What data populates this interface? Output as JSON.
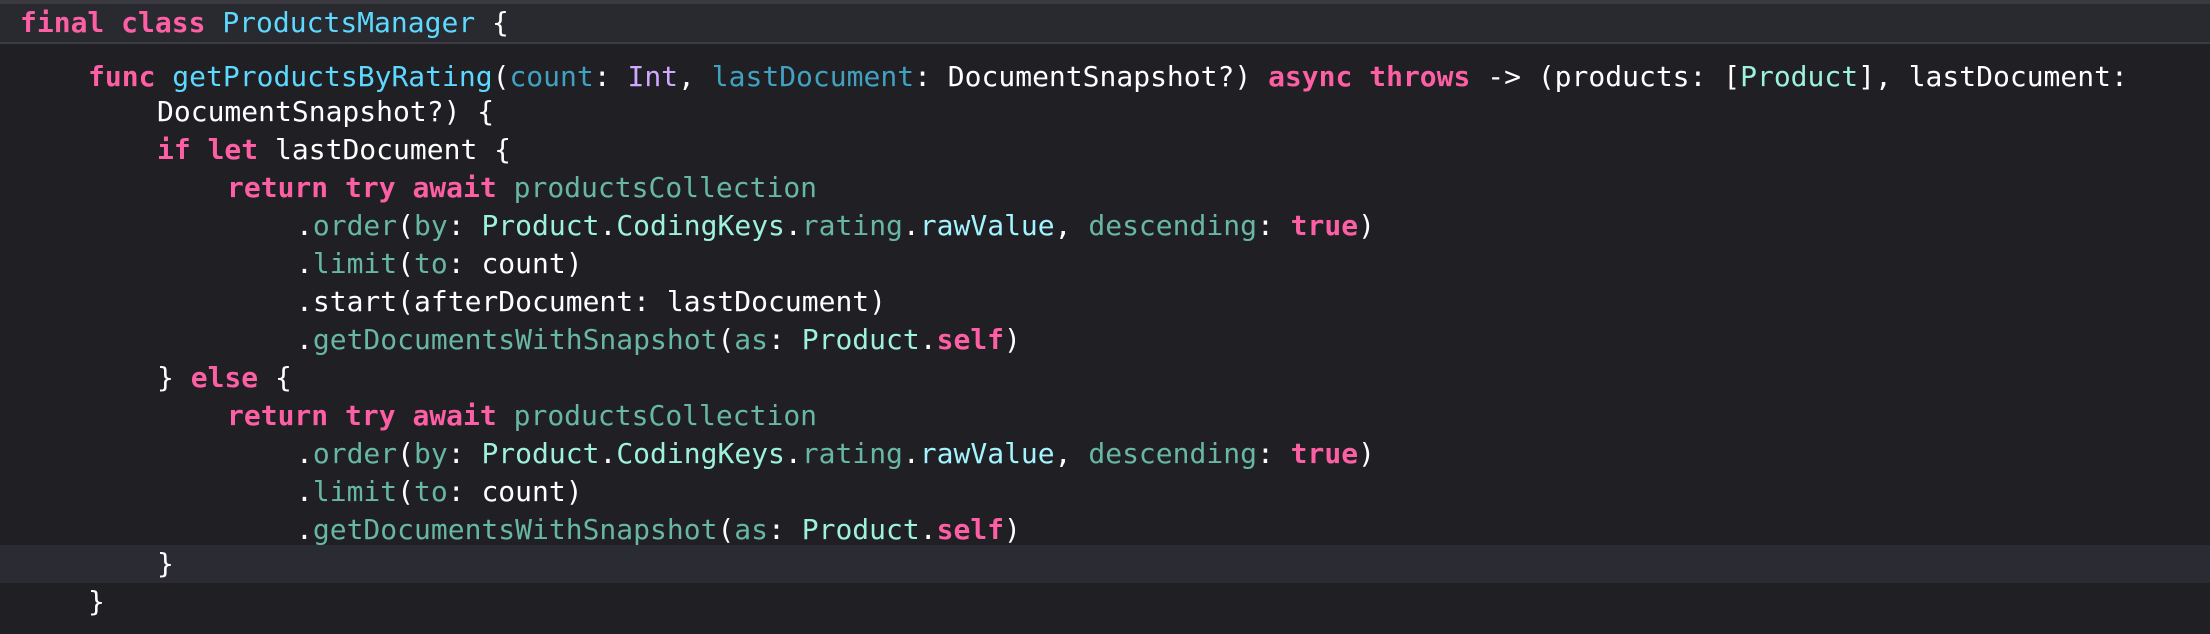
{
  "editor": {
    "language": "Swift",
    "theme_colors": {
      "background": "#1f1f24",
      "header_background": "#292a30",
      "current_line": "#2b2c33",
      "keyword": "#fc5fa3",
      "declaration": "#5dd8ff",
      "type": "#9ef1dd",
      "property": "#67b7a4",
      "other_property": "#a167e6",
      "text": "#ffffff"
    },
    "lines": [
      {
        "indent": 0,
        "tokens": [
          {
            "text": "final",
            "kind": "kw"
          },
          {
            "text": " ",
            "kind": "plain"
          },
          {
            "text": "class",
            "kind": "kw"
          },
          {
            "text": " ",
            "kind": "plain"
          },
          {
            "text": "ProductsManager",
            "kind": "decl"
          },
          {
            "text": " {",
            "kind": "plain"
          }
        ]
      },
      {
        "indent": 1,
        "tokens": [
          {
            "text": "func",
            "kind": "kw"
          },
          {
            "text": " ",
            "kind": "plain"
          },
          {
            "text": "getProductsByRating",
            "kind": "decl"
          },
          {
            "text": "(",
            "kind": "plain"
          },
          {
            "text": "count",
            "kind": "pc"
          },
          {
            "text": ": ",
            "kind": "plain"
          },
          {
            "text": "Int",
            "kind": "type"
          },
          {
            "text": ", ",
            "kind": "plain"
          },
          {
            "text": "lastDocument",
            "kind": "pc"
          },
          {
            "text": ": DocumentSnapshot?) ",
            "kind": "plain"
          },
          {
            "text": "async",
            "kind": "kw"
          },
          {
            "text": " ",
            "kind": "plain"
          },
          {
            "text": "throws",
            "kind": "kw"
          },
          {
            "text": " -> (products: [",
            "kind": "plain"
          },
          {
            "text": "Product",
            "kind": "cls"
          },
          {
            "text": "], lastDocument:",
            "kind": "plain"
          }
        ]
      },
      {
        "indent": 2,
        "tokens": [
          {
            "text": "DocumentSnapshot?) {",
            "kind": "plain"
          }
        ]
      },
      {
        "indent": 2,
        "tokens": [
          {
            "text": "if",
            "kind": "kw"
          },
          {
            "text": " ",
            "kind": "plain"
          },
          {
            "text": "let",
            "kind": "kw"
          },
          {
            "text": " lastDocument {",
            "kind": "plain"
          }
        ]
      },
      {
        "indent": 3,
        "tokens": [
          {
            "text": "return",
            "kind": "kw"
          },
          {
            "text": " ",
            "kind": "plain"
          },
          {
            "text": "try",
            "kind": "kw"
          },
          {
            "text": " ",
            "kind": "plain"
          },
          {
            "text": "await",
            "kind": "kw"
          },
          {
            "text": " ",
            "kind": "plain"
          },
          {
            "text": "productsCollection",
            "kind": "prop"
          }
        ]
      },
      {
        "indent": 4,
        "tokens": [
          {
            "text": ".",
            "kind": "plain"
          },
          {
            "text": "order",
            "kind": "prop"
          },
          {
            "text": "(",
            "kind": "plain"
          },
          {
            "text": "by",
            "kind": "prop"
          },
          {
            "text": ": ",
            "kind": "plain"
          },
          {
            "text": "Product",
            "kind": "cls"
          },
          {
            "text": ".",
            "kind": "plain"
          },
          {
            "text": "CodingKeys",
            "kind": "cls"
          },
          {
            "text": ".",
            "kind": "plain"
          },
          {
            "text": "rating",
            "kind": "prop"
          },
          {
            "text": ".",
            "kind": "plain"
          },
          {
            "text": "rawValue",
            "kind": "otype"
          },
          {
            "text": ", ",
            "kind": "plain"
          },
          {
            "text": "descending",
            "kind": "prop"
          },
          {
            "text": ": ",
            "kind": "plain"
          },
          {
            "text": "true",
            "kind": "kw"
          },
          {
            "text": ")",
            "kind": "plain"
          }
        ]
      },
      {
        "indent": 4,
        "tokens": [
          {
            "text": ".",
            "kind": "plain"
          },
          {
            "text": "limit",
            "kind": "prop"
          },
          {
            "text": "(",
            "kind": "plain"
          },
          {
            "text": "to",
            "kind": "prop"
          },
          {
            "text": ": count)",
            "kind": "plain"
          }
        ]
      },
      {
        "indent": 4,
        "tokens": [
          {
            "text": ".start(afterDocument: lastDocument)",
            "kind": "plain"
          }
        ]
      },
      {
        "indent": 4,
        "tokens": [
          {
            "text": ".",
            "kind": "plain"
          },
          {
            "text": "getDocumentsWithSnapshot",
            "kind": "prop"
          },
          {
            "text": "(",
            "kind": "plain"
          },
          {
            "text": "as",
            "kind": "prop"
          },
          {
            "text": ": ",
            "kind": "plain"
          },
          {
            "text": "Product",
            "kind": "cls"
          },
          {
            "text": ".",
            "kind": "plain"
          },
          {
            "text": "self",
            "kind": "kw"
          },
          {
            "text": ")",
            "kind": "plain"
          }
        ]
      },
      {
        "indent": 2,
        "tokens": [
          {
            "text": "} ",
            "kind": "plain"
          },
          {
            "text": "else",
            "kind": "kw"
          },
          {
            "text": " {",
            "kind": "plain"
          }
        ]
      },
      {
        "indent": 3,
        "tokens": [
          {
            "text": "return",
            "kind": "kw"
          },
          {
            "text": " ",
            "kind": "plain"
          },
          {
            "text": "try",
            "kind": "kw"
          },
          {
            "text": " ",
            "kind": "plain"
          },
          {
            "text": "await",
            "kind": "kw"
          },
          {
            "text": " ",
            "kind": "plain"
          },
          {
            "text": "productsCollection",
            "kind": "prop"
          }
        ]
      },
      {
        "indent": 4,
        "tokens": [
          {
            "text": ".",
            "kind": "plain"
          },
          {
            "text": "order",
            "kind": "prop"
          },
          {
            "text": "(",
            "kind": "plain"
          },
          {
            "text": "by",
            "kind": "prop"
          },
          {
            "text": ": ",
            "kind": "plain"
          },
          {
            "text": "Product",
            "kind": "cls"
          },
          {
            "text": ".",
            "kind": "plain"
          },
          {
            "text": "CodingKeys",
            "kind": "cls"
          },
          {
            "text": ".",
            "kind": "plain"
          },
          {
            "text": "rating",
            "kind": "prop"
          },
          {
            "text": ".",
            "kind": "plain"
          },
          {
            "text": "rawValue",
            "kind": "otype"
          },
          {
            "text": ", ",
            "kind": "plain"
          },
          {
            "text": "descending",
            "kind": "prop"
          },
          {
            "text": ": ",
            "kind": "plain"
          },
          {
            "text": "true",
            "kind": "kw"
          },
          {
            "text": ")",
            "kind": "plain"
          }
        ]
      },
      {
        "indent": 4,
        "tokens": [
          {
            "text": ".",
            "kind": "plain"
          },
          {
            "text": "limit",
            "kind": "prop"
          },
          {
            "text": "(",
            "kind": "plain"
          },
          {
            "text": "to",
            "kind": "prop"
          },
          {
            "text": ": count)",
            "kind": "plain"
          }
        ]
      },
      {
        "indent": 4,
        "tokens": [
          {
            "text": ".",
            "kind": "plain"
          },
          {
            "text": "getDocumentsWithSnapshot",
            "kind": "prop"
          },
          {
            "text": "(",
            "kind": "plain"
          },
          {
            "text": "as",
            "kind": "prop"
          },
          {
            "text": ": ",
            "kind": "plain"
          },
          {
            "text": "Product",
            "kind": "cls"
          },
          {
            "text": ".",
            "kind": "plain"
          },
          {
            "text": "self",
            "kind": "kw"
          },
          {
            "text": ")",
            "kind": "plain"
          }
        ]
      },
      {
        "indent": 2,
        "current": true,
        "tokens": [
          {
            "text": "}",
            "kind": "plain"
          }
        ]
      },
      {
        "indent": 1,
        "tokens": [
          {
            "text": "}",
            "kind": "plain"
          }
        ]
      }
    ]
  }
}
